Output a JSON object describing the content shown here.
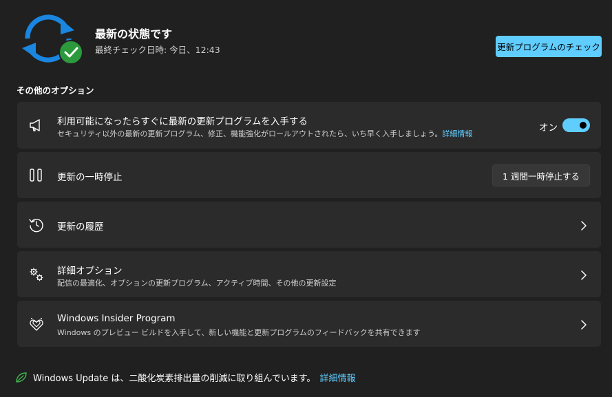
{
  "status": {
    "title": "最新の状態です",
    "last_checked": "最終チェック日時: 今日、12:43",
    "check_button": "更新プログラムのチェック"
  },
  "section_title": "その他のオプション",
  "options": {
    "latest": {
      "label": "利用可能になったらすぐに最新の更新プログラムを入手する",
      "description": "セキュリティ以外の最新の更新プログラム、修正、機能強化がロールアウトされたら、いち早く入手しましょう。",
      "link": "詳細情報",
      "toggle_label": "オン",
      "toggle_on": true,
      "icon": "megaphone-icon"
    },
    "pause": {
      "label": "更新の一時停止",
      "button": "1 週間一時停止する",
      "icon": "pause-icon"
    },
    "history": {
      "label": "更新の履歴",
      "icon": "history-icon"
    },
    "advanced": {
      "label": "詳細オプション",
      "description": "配信の最適化、オプションの更新プログラム、アクティブ時間、その他の更新設定",
      "icon": "gears-icon"
    },
    "insider": {
      "label": "Windows Insider Program",
      "description": "Windows のプレビュー ビルドを入手して、新しい機能と更新プログラムのフィードバックを共有できます",
      "icon": "insider-hearts-icon"
    }
  },
  "footer": {
    "text": "Windows Update は、二酸化炭素排出量の削減に取り組んでいます。",
    "link": "詳細情報",
    "icon": "leaf-icon"
  },
  "colors": {
    "background": "#202020",
    "card": "#2b2b2b",
    "accent": "#60cdff",
    "sync_blue": "#1a86e0",
    "success_green": "#2c9a3c"
  }
}
